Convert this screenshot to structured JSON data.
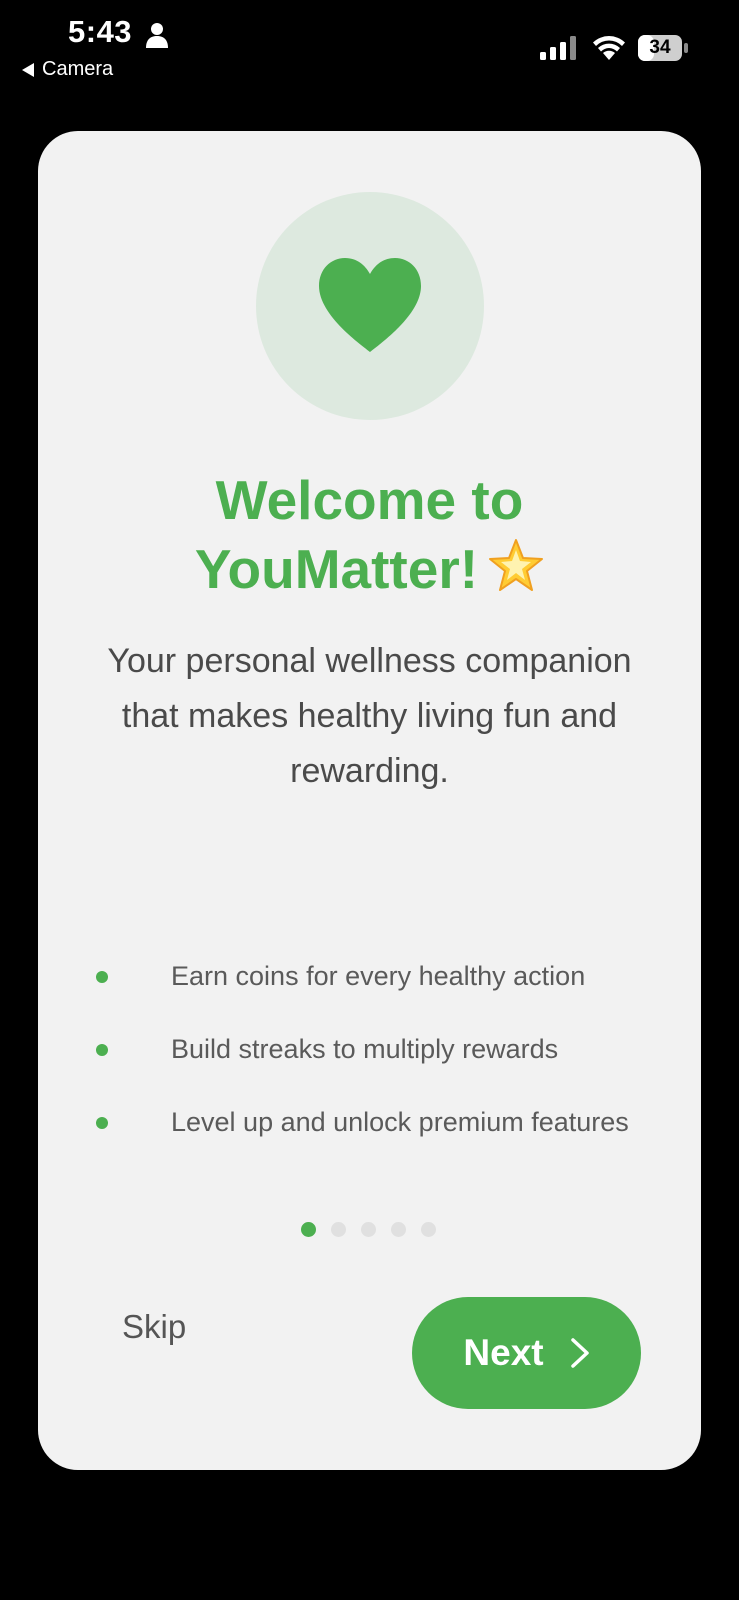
{
  "status_bar": {
    "time": "5:43",
    "back_app": "Camera",
    "battery": "34",
    "icons": [
      "person-icon",
      "signal-icon",
      "wifi-icon",
      "battery-icon"
    ]
  },
  "onboarding": {
    "hero_icon": "heart-icon",
    "title": "Welcome to YouMatter!",
    "title_emoji": "star-icon",
    "subtitle": "Your personal wellness companion that makes healthy living fun and rewarding.",
    "features": [
      "Earn coins for every healthy action",
      "Build streaks to multiply rewards",
      "Level up and unlock premium features"
    ],
    "pagination": {
      "total": 5,
      "current": 1
    },
    "skip_label": "Skip",
    "next_label": "Next"
  },
  "colors": {
    "accent": "#4caf50",
    "card_background": "#f2f2f2",
    "hero_circle": "#dde9df",
    "body_text": "#4a4a4a"
  }
}
